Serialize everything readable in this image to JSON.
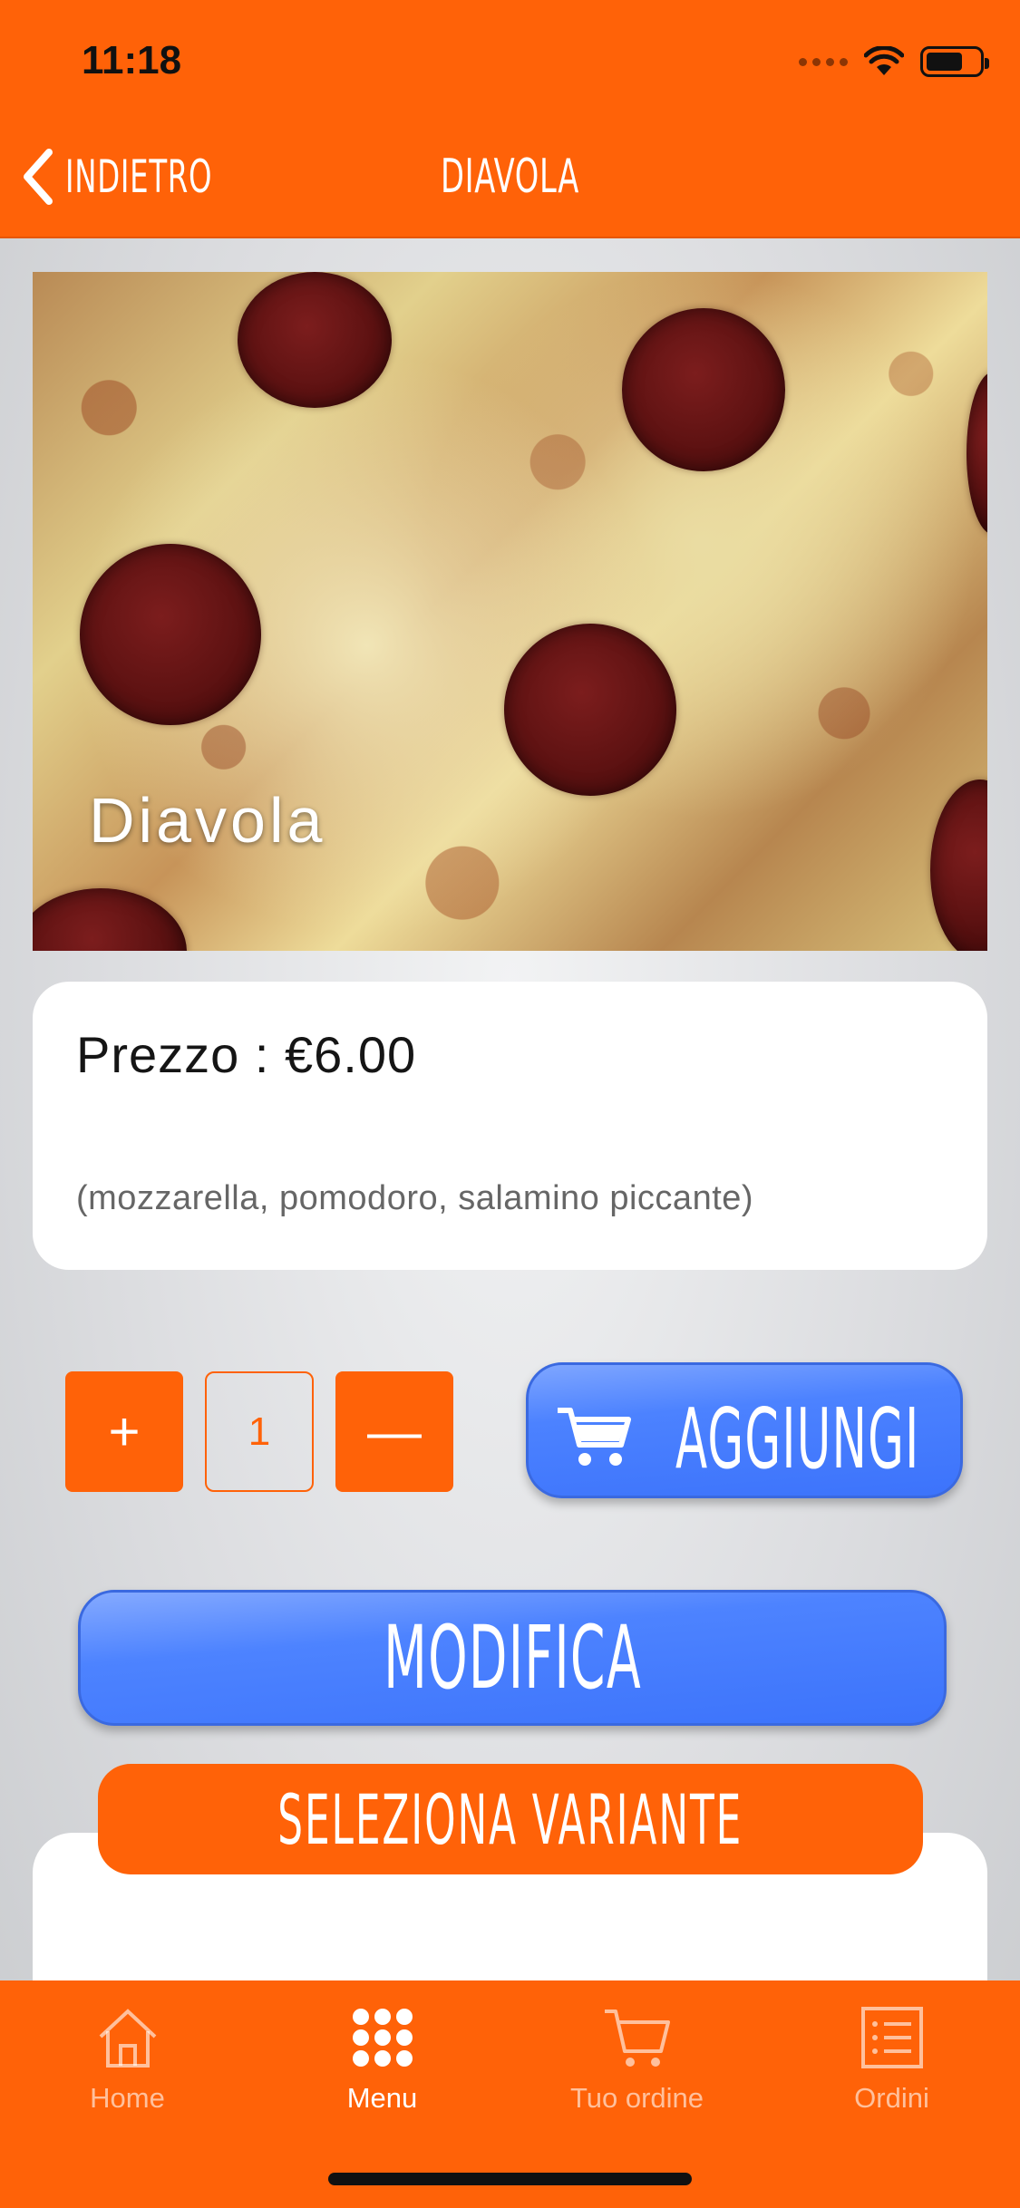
{
  "status_bar": {
    "time": "11:18"
  },
  "nav": {
    "back_label": "INDIETRO",
    "title": "DIAVOLA"
  },
  "hero": {
    "caption": "Diavola"
  },
  "product": {
    "price_text": "Prezzo : €6.00",
    "ingredients": "(mozzarella, pomodoro, salamino piccante)"
  },
  "quantity": {
    "plus": "+",
    "value": "1",
    "minus": "—"
  },
  "buttons": {
    "add": "AGGIUNGI",
    "modify": "MODIFICA",
    "select_variant": "SELEZIONA VARIANTE"
  },
  "tabbar": {
    "items": [
      {
        "label": "Home",
        "icon": "home-icon",
        "active": false
      },
      {
        "label": "Menu",
        "icon": "grid-icon",
        "active": true
      },
      {
        "label": "Tuo ordine",
        "icon": "cart-icon",
        "active": false
      },
      {
        "label": "Ordini",
        "icon": "list-icon",
        "active": false
      }
    ]
  },
  "colors": {
    "brand_orange": "#ff6208",
    "action_blue": "#4c82ff"
  }
}
